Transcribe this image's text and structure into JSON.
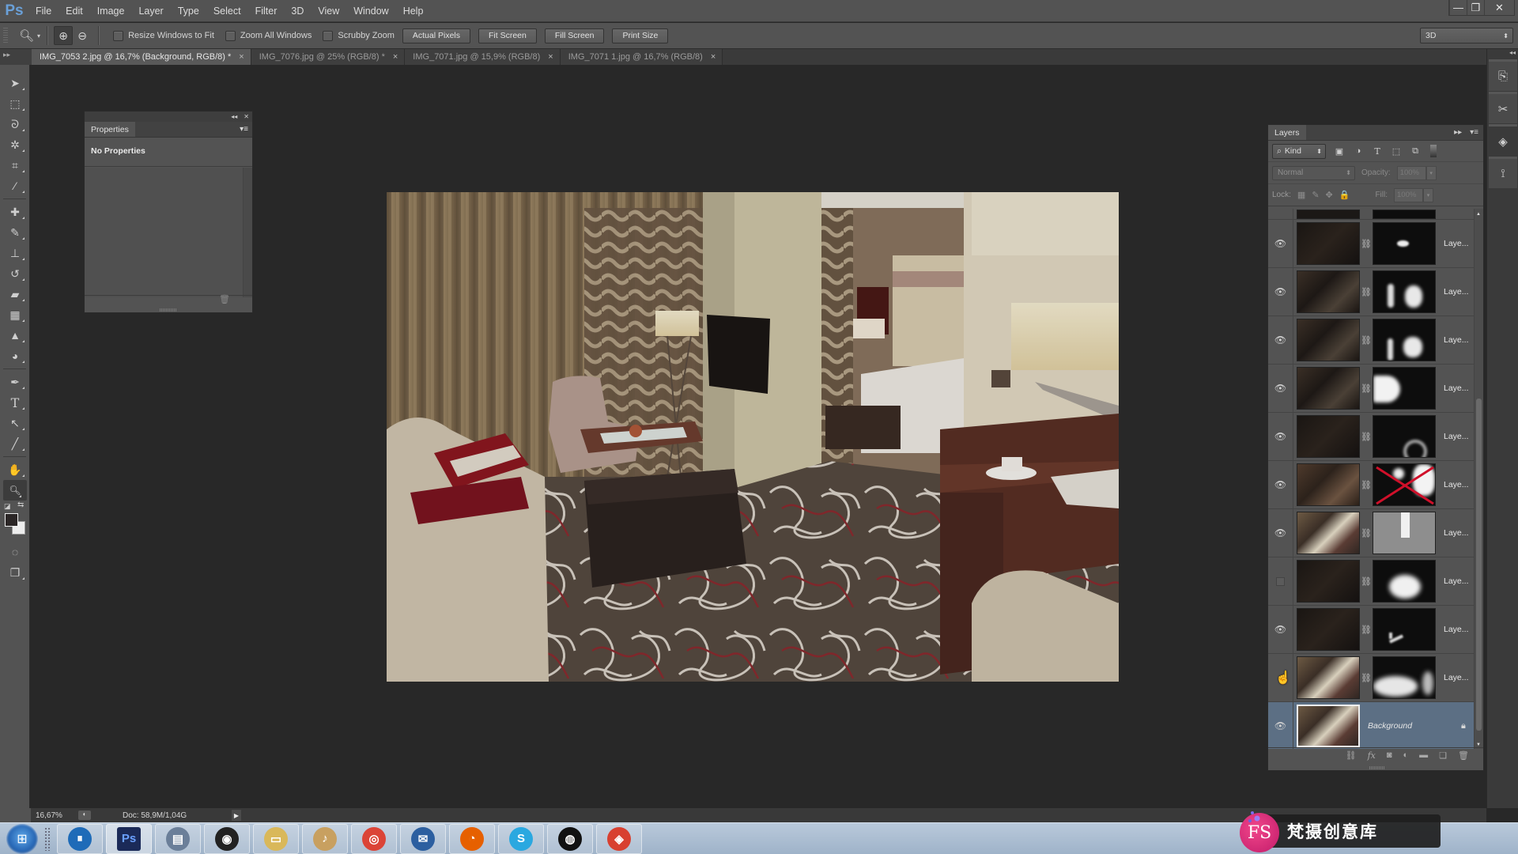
{
  "app": {
    "logo": "Ps",
    "menu": [
      "File",
      "Edit",
      "Image",
      "Layer",
      "Type",
      "Select",
      "Filter",
      "3D",
      "View",
      "Window",
      "Help"
    ],
    "window_controls": {
      "minimize": "—",
      "restore": "❐",
      "close": "✕"
    }
  },
  "options_bar": {
    "tool_icon": "zoom-tool-icon",
    "zoom_in_icon": "⊕",
    "zoom_out_icon": "⊖",
    "checkboxes": [
      {
        "label": "Resize Windows to Fit",
        "checked": false
      },
      {
        "label": "Zoom All Windows",
        "checked": false
      },
      {
        "label": "Scrubby Zoom",
        "checked": false
      }
    ],
    "buttons": [
      "Actual Pixels",
      "Fit Screen",
      "Fill Screen",
      "Print Size"
    ],
    "workspace": "3D"
  },
  "tabs": [
    {
      "label": "IMG_7053 2.jpg @ 16,7% (Background, RGB/8) *",
      "active": true
    },
    {
      "label": "IMG_7076.jpg @ 25% (RGB/8) *",
      "active": false
    },
    {
      "label": "IMG_7071.jpg @ 15,9% (RGB/8)",
      "active": false
    },
    {
      "label": "IMG_7071 1.jpg @ 16,7% (RGB/8)",
      "active": false
    }
  ],
  "tab_close": "×",
  "tools": [
    {
      "name": "move-tool",
      "glyph": "➤"
    },
    {
      "name": "marquee-tool",
      "glyph": "⬚"
    },
    {
      "name": "lasso-tool",
      "glyph": "ᘐ"
    },
    {
      "name": "magic-wand-tool",
      "glyph": "✲"
    },
    {
      "name": "crop-tool",
      "glyph": "⌗"
    },
    {
      "name": "eyedropper-tool",
      "glyph": "⁄"
    },
    {
      "name": "healing-brush-tool",
      "glyph": "✚"
    },
    {
      "name": "brush-tool",
      "glyph": "✎"
    },
    {
      "name": "clone-stamp-tool",
      "glyph": "⊥"
    },
    {
      "name": "history-brush-tool",
      "glyph": "↺"
    },
    {
      "name": "eraser-tool",
      "glyph": "▰"
    },
    {
      "name": "gradient-tool",
      "glyph": "▦"
    },
    {
      "name": "blur-tool",
      "glyph": "▲"
    },
    {
      "name": "dodge-tool",
      "glyph": "◕"
    },
    {
      "name": "pen-tool",
      "glyph": "✒"
    },
    {
      "name": "type-tool",
      "glyph": "T"
    },
    {
      "name": "path-selection-tool",
      "glyph": "↖"
    },
    {
      "name": "line-tool",
      "glyph": "╱"
    },
    {
      "name": "hand-tool",
      "glyph": "✋"
    },
    {
      "name": "zoom-tool",
      "glyph": "🔍"
    }
  ],
  "colors": {
    "foreground": "#2b2626",
    "background": "#ededed"
  },
  "quick_mask_glyph": "◌",
  "screen_mode_glyph": "❐",
  "properties": {
    "tab": "Properties",
    "title": "No Properties",
    "menu_glyph": "▾≡",
    "collapse": "◂◂",
    "close": "✕",
    "trash_glyph": "🗑"
  },
  "layers": {
    "tab": "Layers",
    "filter_kind": "Kind",
    "filter_icons": [
      "▣",
      "◑",
      "T",
      "⬚",
      "⧉"
    ],
    "blend_mode": "Normal",
    "opacity_label": "Opacity:",
    "opacity": "100%",
    "lock_label": "Lock:",
    "lock_icons": [
      "▦",
      "✎",
      "✥",
      "🔒"
    ],
    "fill_label": "Fill:",
    "fill": "100%",
    "rows": [
      {
        "name": "Laye...",
        "visible": true,
        "thumb": "dark",
        "mask": "small-blob"
      },
      {
        "name": "Laye...",
        "visible": true,
        "thumb": "mid",
        "mask": "figure"
      },
      {
        "name": "Laye...",
        "visible": true,
        "thumb": "mid",
        "mask": "figure2"
      },
      {
        "name": "Laye...",
        "visible": true,
        "thumb": "mid",
        "mask": "left-blob"
      },
      {
        "name": "Laye...",
        "visible": true,
        "thumb": "dark",
        "mask": "arc"
      },
      {
        "name": "Laye...",
        "visible": true,
        "thumb": "warm",
        "mask": "disabled"
      },
      {
        "name": "Laye...",
        "visible": true,
        "thumb": "bright",
        "mask": "gray-rect"
      },
      {
        "name": "Laye...",
        "visible": false,
        "thumb": "dark",
        "mask": "center-blob"
      },
      {
        "name": "Laye...",
        "visible": true,
        "thumb": "dark",
        "mask": "small-line"
      },
      {
        "name": "Laye...",
        "visible": true,
        "thumb": "bright",
        "mask": "bottom-blob"
      },
      {
        "name": "Background",
        "visible": true,
        "thumb": "bright",
        "mask": null,
        "locked": true,
        "selected": true
      }
    ],
    "footer_icons": [
      "⛓",
      "fx",
      "◙",
      "◐",
      "▬",
      "❏",
      "🗑"
    ]
  },
  "right_dock": [
    "history-icon",
    "tools-preset-icon",
    "layers-icon",
    "paths-icon"
  ],
  "status": {
    "zoom": "16,67%",
    "doc": "Doc: 58,9M/1,04G",
    "arrow": "▶"
  },
  "taskbar": {
    "apps": [
      {
        "name": "teamviewer",
        "label": "⏸",
        "color": "#1e6bb8"
      },
      {
        "name": "photoshop",
        "label": "Ps",
        "color": "#1b2a58",
        "active": true
      },
      {
        "name": "photo-viewer",
        "label": "▤",
        "color": "#6b7f99"
      },
      {
        "name": "camera-app",
        "label": "◉",
        "color": "#222"
      },
      {
        "name": "file-explorer",
        "label": "▭",
        "color": "#d9b85a"
      },
      {
        "name": "audio-app",
        "label": "♪",
        "color": "#c8a060"
      },
      {
        "name": "chrome",
        "label": "◎",
        "color": "#db4437"
      },
      {
        "name": "thunderbird",
        "label": "✉",
        "color": "#2c5fa0"
      },
      {
        "name": "firefox",
        "label": "◔",
        "color": "#e66000"
      },
      {
        "name": "skype",
        "label": "S",
        "color": "#2aa8e0"
      },
      {
        "name": "obs",
        "label": "◍",
        "color": "#111"
      },
      {
        "name": "faststone",
        "label": "◈",
        "color": "#d84030"
      }
    ]
  },
  "watermark": {
    "logo": "FS",
    "text": "梵摄创意库"
  }
}
